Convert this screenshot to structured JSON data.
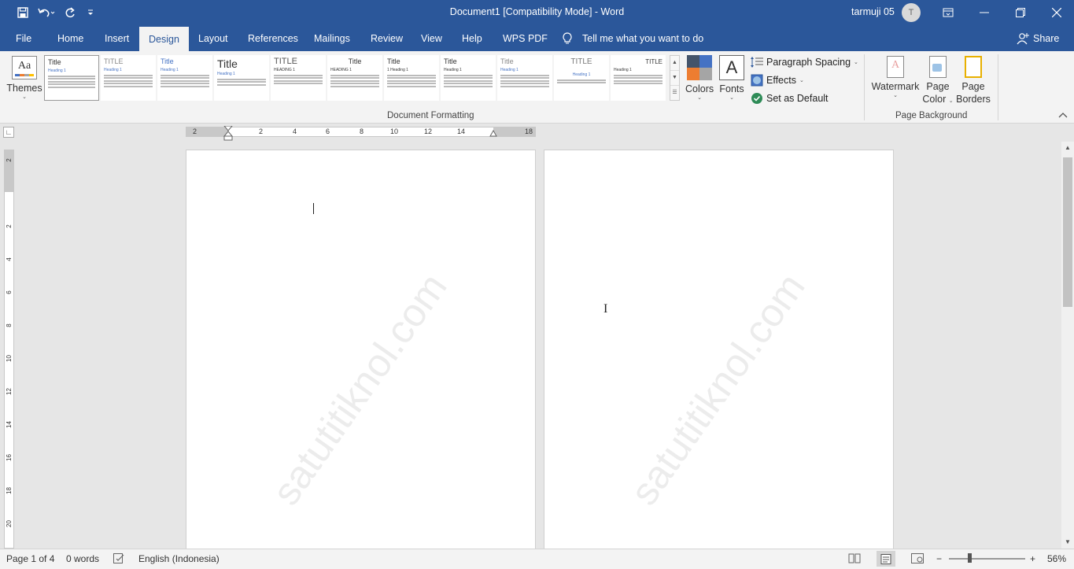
{
  "window": {
    "title": "Document1 [Compatibility Mode]  -  Word",
    "user_name": "tarmuji 05",
    "avatar_initial": "T"
  },
  "qat": {
    "save_icon": "save-icon",
    "undo_icon": "undo-icon",
    "redo_icon": "redo-icon",
    "customize_icon": "customize-qat-icon"
  },
  "tabs": [
    "File",
    "Home",
    "Insert",
    "Design",
    "Layout",
    "References",
    "Mailings",
    "Review",
    "View",
    "Help",
    "WPS PDF"
  ],
  "active_tab": "Design",
  "tell_me": "Tell me what you want to do",
  "share_label": "Share",
  "ribbon": {
    "themes_label": "Themes",
    "style_titles": [
      "Title",
      "TITLE",
      "Title",
      "Title",
      "TITLE",
      "Title",
      "Title",
      "Title",
      "Title",
      "TITLE",
      "TITLE"
    ],
    "style_headings": [
      "Heading 1",
      "Heading 1",
      "Heading 1",
      "Heading 1",
      "HEADING 1",
      "HEADING 1",
      "1  Heading 1",
      "Heading 1",
      "Heading 1",
      "Heading 1",
      "Heading 1"
    ],
    "colors_label": "Colors",
    "fonts_label": "Fonts",
    "fonts_glyph": "A",
    "paragraph_spacing_label": "Paragraph Spacing",
    "effects_label": "Effects",
    "set_default_label": "Set as Default",
    "document_formatting_label": "Document Formatting",
    "watermark_label": "Watermark",
    "page_color_label_1": "Page",
    "page_color_label_2": "Color",
    "page_borders_label_1": "Page",
    "page_borders_label_2": "Borders",
    "page_background_label": "Page Background",
    "theme_colors": [
      "#44546a",
      "#4472c4",
      "#ed7d31",
      "#a5a5a5"
    ]
  },
  "ruler": {
    "h_numbers": [
      "2",
      "2",
      "4",
      "6",
      "8",
      "10",
      "12",
      "14",
      "18"
    ],
    "v_numbers": [
      "2",
      "2",
      "4",
      "6",
      "8",
      "10",
      "12",
      "14",
      "16",
      "18",
      "20"
    ]
  },
  "document": {
    "watermark_text": "satutitiknol.com"
  },
  "status": {
    "page": "Page 1 of 4",
    "words": "0 words",
    "language": "English (Indonesia)",
    "zoom": "56%"
  },
  "colors": {
    "title_bar": "#2b579a",
    "ribbon_bg": "#f3f3f3",
    "workspace_bg": "#e6e6e6"
  }
}
